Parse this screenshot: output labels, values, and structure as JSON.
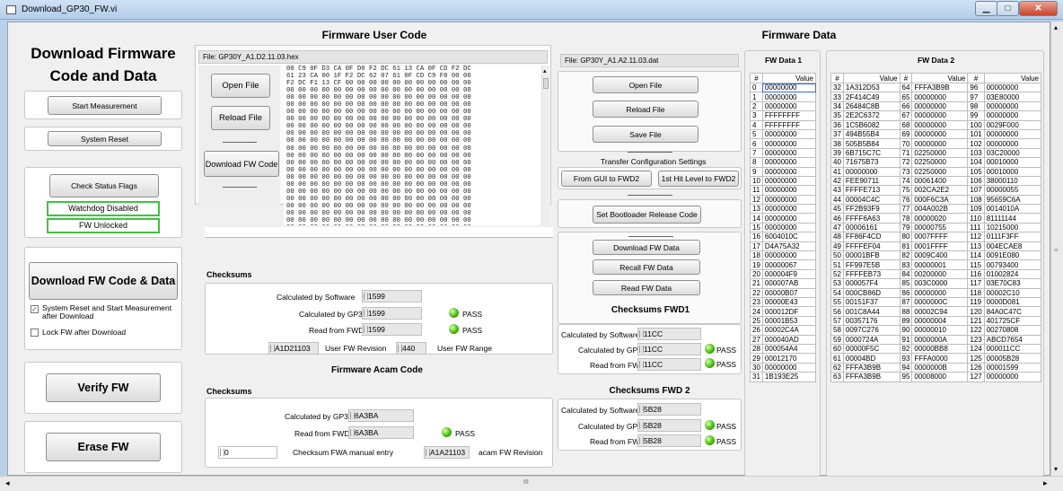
{
  "window": {
    "title": "Download_GP30_FW.vi",
    "min": "▁",
    "max": "□",
    "close": "✕"
  },
  "left": {
    "title_line1": "Download Firmware",
    "title_line2": "Code and Data",
    "start_measurement": "Start Measurement",
    "system_reset": "System Reset",
    "check_status_flags": "Check Status Flags",
    "watchdog": "Watchdog Disabled",
    "fw_unlocked": "FW Unlocked",
    "download_fw_code_data": "Download FW Code & Data",
    "chk_reset_label": "System Reset and Start Measurement after Download",
    "chk_lock_label": "Lock FW after Download",
    "verify_fw": "Verify FW",
    "erase_fw": "Erase FW",
    "chk_reset_mark": "✓"
  },
  "user_code": {
    "header": "Firmware User Code",
    "file": "File:  GP30Y_A1.D2.11.03.hex",
    "open_file": "Open File",
    "reload_file": "Reload File",
    "download_fw_code": "Download FW Code",
    "hex_lines": [
      "00 C9 0F D3 CA 0F D0 F2 DC 61 13 CA 0F CD F2 DC",
      "61 23 CA 00 1F F2 DC 62 07 61 0F CD C9 F0 00 00",
      "F2 DC F1 13 CF 00 00 00 00 00 00 00 00 00 00 00",
      "00 00 00 00 00 00 00 00 00 00 00 00 00 00 00 00",
      "00 00 00 00 00 00 00 00 00 00 00 00 00 00 00 00",
      "00 00 00 00 00 00 00 00 00 00 00 00 00 00 00 00",
      "00 00 00 00 00 00 00 00 00 00 00 00 00 00 00 00",
      "00 00 00 00 00 00 00 00 00 00 00 00 00 00 00 00",
      "00 00 00 00 00 00 00 00 00 00 00 00 00 00 00 00",
      "00 00 00 00 00 00 00 00 00 00 00 00 00 00 00 00",
      "00 00 00 00 00 00 00 00 00 00 00 00 00 00 00 00",
      "00 00 00 00 00 00 00 00 00 00 00 00 00 00 00 00",
      "00 00 00 00 00 00 00 00 00 00 00 00 00 00 00 00",
      "00 00 00 00 00 00 00 00 00 00 00 00 00 00 00 00",
      "00 00 00 00 00 00 00 00 00 00 00 00 00 00 00 00",
      "00 00 00 00 00 00 00 00 00 00 00 00 00 00 00 00",
      "00 00 00 00 00 00 00 00 00 00 00 00 00 00 00 00",
      "00 00 00 00 00 00 00 00 00 00 00 00 00 00 00 00",
      "00 00 00 00 00 00 00 00 00 00 00 00 00 00 00 00",
      "00 00 00 00 00 00 00 00 00 00 00 00 00 00 00 00",
      "00 00 00 00 00 00 00 00 00 00 00 00 00 00 00 00",
      "00 00 00 00 00 00 00 00 00 00 00 00 00 00 00 00",
      "00 00 00 00 00 00 00 00 00 00 00 00 00 00 00 00",
      "00 00 00 00 00 00 00 00 00 00 00 00 00 00 00 00",
      "00 00 00 00 00 00 00 00 00 00 00 00 00 00 00 00",
      "00 00 00 00 00 00 00 00 00 00 00 00 00 00 00 00",
      "00 00 00 00 00 00 00 00 00 00 00 00 00 00 00 00"
    ],
    "checksums_title": "Checksums",
    "calc_sw_label": "Calculated by Software",
    "calc_sw": "1599",
    "calc_gp30_label": "Calculated by GP30",
    "calc_gp30": "1599",
    "read_fwd2_label": "Read from FWD2",
    "read_fwd2": "1599",
    "pass": "PASS",
    "user_fw_rev": "A1D21103",
    "user_fw_rev_label": "User FW Revision",
    "user_fw_range": "440",
    "user_fw_range_label": "User FW Range"
  },
  "acam": {
    "header": "Firmware Acam Code",
    "checksums_title": "Checksums",
    "calc_gp30_label": "Calculated by GP30",
    "calc_gp30": "6A3BA",
    "read_fwd2_label": "Read from FWD2",
    "read_fwd2": "6A3BA",
    "pass": "PASS",
    "manual": "0",
    "manual_label": "Checksum FWA manual entry",
    "acam_rev": "A1A21103",
    "acam_rev_label": "acam FW Revision"
  },
  "fw_data": {
    "header": "Firmware Data",
    "file": "File:  GP30Y_A1.A2.11.03.dat",
    "open_file": "Open File",
    "reload_file": "Reload File",
    "save_file": "Save File",
    "transfer_title": "Transfer Configuration Settings",
    "gui_to_fwd2": "From GUI to FWD2",
    "hit_level": "1st Hit Level to FWD2",
    "bootloader": "Set Bootloader Release Code",
    "download_fw_data": "Download FW Data",
    "recall_fw_data": "Recall FW Data",
    "read_fw_data": "Read FW Data",
    "fwd1_title": "Checksums FWD1",
    "fwd1_sw_label": "Calculated by Software",
    "fwd1_sw": "11CC",
    "fwd1_gp30_label": "Calculated by GP30",
    "fwd1_gp30": "11CC",
    "fwd1_read_label": "Read from FWD2",
    "fwd1_read": "11CC",
    "fwd2_title": "Checksums FWD 2",
    "fwd2_sw_label": "Calculated by Software",
    "fwd2_sw": "5B28",
    "fwd2_gp30_label": "Calculated by GP30",
    "fwd2_gp30": "5B28",
    "fwd2_read_label": "Read from FWD2",
    "fwd2_read": "5B28",
    "pass": "PASS"
  },
  "table1": {
    "title": "FW Data 1",
    "col_num": "#",
    "col_value": "Value",
    "rows": [
      [
        "0",
        "00000000"
      ],
      [
        "1",
        "00000000"
      ],
      [
        "2",
        "00000000"
      ],
      [
        "3",
        "FFFFFFFF"
      ],
      [
        "4",
        "FFFFFFFF"
      ],
      [
        "5",
        "00000000"
      ],
      [
        "6",
        "00000000"
      ],
      [
        "7",
        "00000000"
      ],
      [
        "8",
        "00000000"
      ],
      [
        "9",
        "00000000"
      ],
      [
        "10",
        "00000000"
      ],
      [
        "11",
        "00000000"
      ],
      [
        "12",
        "00000000"
      ],
      [
        "13",
        "00000000"
      ],
      [
        "14",
        "00000000"
      ],
      [
        "15",
        "00000000"
      ],
      [
        "16",
        "6004010C"
      ],
      [
        "17",
        "D4A75A32"
      ],
      [
        "18",
        "00000000"
      ],
      [
        "19",
        "00000067"
      ],
      [
        "20",
        "000004F9"
      ],
      [
        "21",
        "000007AB"
      ],
      [
        "22",
        "00000B07"
      ],
      [
        "23",
        "00000E43"
      ],
      [
        "24",
        "000012DF"
      ],
      [
        "25",
        "00001B53"
      ],
      [
        "26",
        "00002C4A"
      ],
      [
        "27",
        "000040AD"
      ],
      [
        "28",
        "000054A4"
      ],
      [
        "29",
        "00012170"
      ],
      [
        "30",
        "00000000"
      ],
      [
        "31",
        "1B193E25"
      ]
    ]
  },
  "table2": {
    "title": "FW Data 2",
    "col_num": "#",
    "col_value": "Value",
    "rows": [
      [
        "32",
        "1A312D53",
        "64",
        "FFFA3B9B",
        "96",
        "00000000"
      ],
      [
        "33",
        "2F414C49",
        "65",
        "00000000",
        "97",
        "03E80000"
      ],
      [
        "34",
        "26484C8B",
        "66",
        "00000000",
        "98",
        "00000000"
      ],
      [
        "35",
        "2E2C6372",
        "67",
        "00000000",
        "99",
        "00000000"
      ],
      [
        "36",
        "1C5B6082",
        "68",
        "00000000",
        "100",
        "0029F000"
      ],
      [
        "37",
        "494B55B4",
        "69",
        "00000000",
        "101",
        "00000000"
      ],
      [
        "38",
        "505B5B84",
        "70",
        "00000000",
        "102",
        "00000000"
      ],
      [
        "39",
        "6B715C7C",
        "71",
        "02250000",
        "103",
        "03C20000"
      ],
      [
        "40",
        "71675B73",
        "72",
        "02250000",
        "104",
        "00010000"
      ],
      [
        "41",
        "00000000",
        "73",
        "02250000",
        "105",
        "00010000"
      ],
      [
        "42",
        "FEE90711",
        "74",
        "00061400",
        "106",
        "38000110"
      ],
      [
        "43",
        "FFFFE713",
        "75",
        "002CA2E2",
        "107",
        "00000055"
      ],
      [
        "44",
        "00004C4C",
        "76",
        "000F6C3A",
        "108",
        "95659C6A"
      ],
      [
        "45",
        "FF2B93F9",
        "77",
        "004A002B",
        "109",
        "0014010A"
      ],
      [
        "46",
        "FFFF6A63",
        "78",
        "00000020",
        "110",
        "81111144"
      ],
      [
        "47",
        "00006161",
        "79",
        "00000755",
        "111",
        "10215000"
      ],
      [
        "48",
        "FF86F4CD",
        "80",
        "0007FFFF",
        "112",
        "0111F3FF"
      ],
      [
        "49",
        "FFFFEF04",
        "81",
        "0001FFFF",
        "113",
        "004ECAE8"
      ],
      [
        "50",
        "00001BFB",
        "82",
        "0009C400",
        "114",
        "0091E080"
      ],
      [
        "51",
        "FF997E5B",
        "83",
        "00000001",
        "115",
        "00793400"
      ],
      [
        "52",
        "FFFFEB73",
        "84",
        "00200000",
        "116",
        "01002824"
      ],
      [
        "53",
        "000057F4",
        "85",
        "003C0000",
        "117",
        "03E70C83"
      ],
      [
        "54",
        "000CB86D",
        "86",
        "00000000",
        "118",
        "00002C10"
      ],
      [
        "55",
        "00151F37",
        "87",
        "0000000C",
        "119",
        "0000D081"
      ],
      [
        "56",
        "001C8A44",
        "88",
        "00002C94",
        "120",
        "84A0C47C"
      ],
      [
        "57",
        "00357176",
        "89",
        "00000004",
        "121",
        "401725CF"
      ],
      [
        "58",
        "0097C276",
        "90",
        "00000010",
        "122",
        "00270808"
      ],
      [
        "59",
        "0000724A",
        "91",
        "0000000A",
        "123",
        "ABCD7654"
      ],
      [
        "60",
        "00000F5C",
        "92",
        "00000BB8",
        "124",
        "000011CC"
      ],
      [
        "61",
        "00004BD",
        "93",
        "FFFA0000",
        "125",
        "00005B28"
      ],
      [
        "62",
        "FFFA3B9B",
        "94",
        "0000000B",
        "126",
        "00001599"
      ],
      [
        "63",
        "FFFA3B9B",
        "95",
        "00008000",
        "127",
        "00000000"
      ]
    ]
  },
  "scroll": {
    "mid": "III",
    "left": "◂",
    "right": "▸",
    "up": "▴",
    "down": "▾",
    "side": "≡"
  }
}
